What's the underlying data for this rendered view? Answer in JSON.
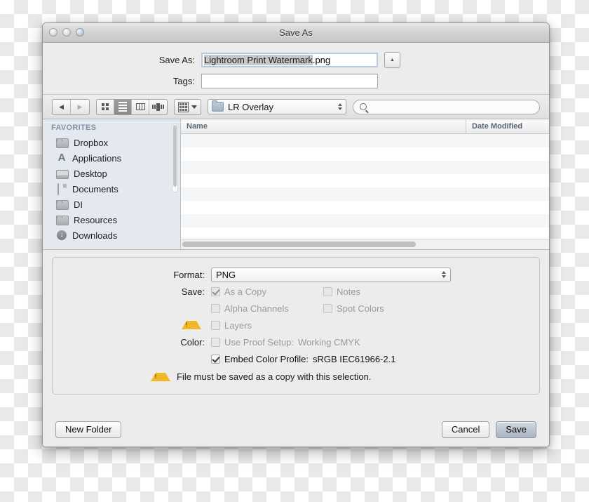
{
  "window": {
    "title": "Save As",
    "traffic_lights": [
      "close-button",
      "minimize-button",
      "zoom-button"
    ]
  },
  "name_area": {
    "save_as_label": "Save As:",
    "filename_selected": "Lightroom Print Watermark",
    "filename_extension": ".png",
    "filename_full": "Lightroom Print Watermark.png",
    "tags_label": "Tags:",
    "tags_value": "",
    "tags_placeholder": "",
    "disclosure_glyph": "▲"
  },
  "toolbar": {
    "back_glyph": "◀",
    "forward_glyph": "▶",
    "view_modes": [
      {
        "name": "icon-view",
        "selected": false
      },
      {
        "name": "list-view",
        "selected": true
      },
      {
        "name": "column-view",
        "selected": false
      },
      {
        "name": "coverflow-view",
        "selected": false
      }
    ],
    "arrange_label": "",
    "path_location": "LR Overlay",
    "search_placeholder": "",
    "search_value": ""
  },
  "sidebar": {
    "header": "FAVORITES",
    "items": [
      {
        "label": "Dropbox",
        "icon": "folder-icon"
      },
      {
        "label": "Applications",
        "icon": "applications-icon"
      },
      {
        "label": "Desktop",
        "icon": "desktop-icon"
      },
      {
        "label": "Documents",
        "icon": "document-icon"
      },
      {
        "label": "DI",
        "icon": "folder-icon"
      },
      {
        "label": "Resources",
        "icon": "folder-icon"
      },
      {
        "label": "Downloads",
        "icon": "downloads-icon"
      }
    ]
  },
  "filelist": {
    "columns": [
      "Name",
      "Date Modified"
    ],
    "rows": []
  },
  "options": {
    "format_label": "Format:",
    "format_value": "PNG",
    "save_label": "Save:",
    "color_label": "Color:",
    "checkboxes": {
      "as_a_copy": {
        "label": "As a Copy",
        "checked": true,
        "enabled": false
      },
      "notes": {
        "label": "Notes",
        "checked": false,
        "enabled": false
      },
      "alpha_channels": {
        "label": "Alpha Channels",
        "checked": false,
        "enabled": false
      },
      "spot_colors": {
        "label": "Spot Colors",
        "checked": false,
        "enabled": false
      },
      "layers": {
        "label": "Layers",
        "checked": false,
        "enabled": false
      },
      "use_proof_setup": {
        "label": "Use Proof Setup:",
        "value": "Working CMYK",
        "checked": false,
        "enabled": false
      },
      "embed_color_profile": {
        "label": "Embed Color Profile:",
        "value": "sRGB IEC61966-2.1",
        "checked": true,
        "enabled": true
      }
    },
    "warning_message": "File must be saved as a copy with this selection."
  },
  "buttons": {
    "new_folder": "New Folder",
    "cancel": "Cancel",
    "save": "Save"
  },
  "colors": {
    "warning_amber": "#f0b726",
    "sidebar_bg": "#e4e9ef",
    "panel_bg": "#ececec",
    "default_button": "#a9b4c0"
  }
}
